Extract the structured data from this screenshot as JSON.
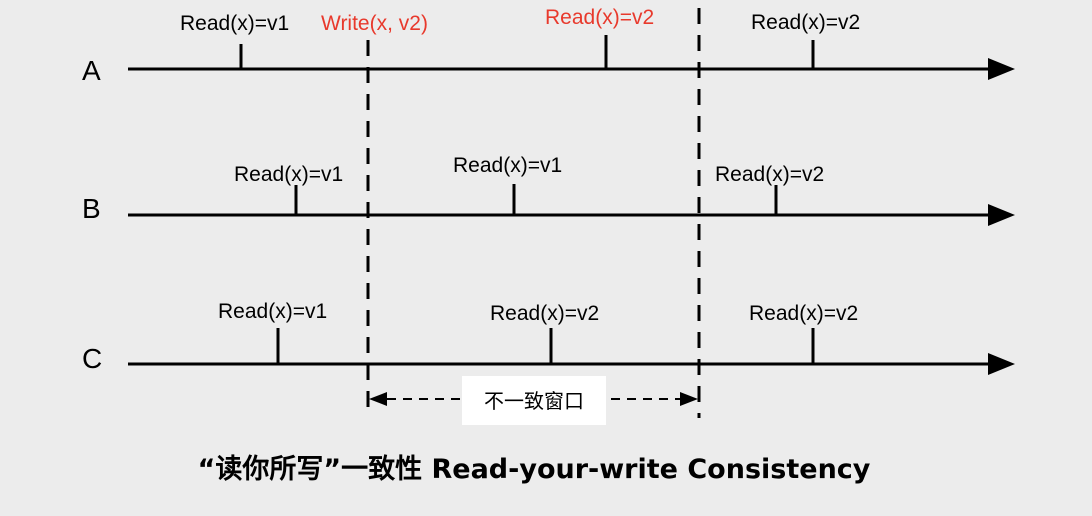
{
  "colors": {
    "background": "#ececec",
    "line": "#000000",
    "highlight": "#e8392c",
    "window_box": "#ffffff"
  },
  "processes": [
    {
      "name": "A",
      "events": [
        {
          "text": "Read(x)=v1",
          "highlight": false
        },
        {
          "text": "Write(x, v2)",
          "highlight": true
        },
        {
          "text": "Read(x)=v2",
          "highlight": true
        },
        {
          "text": "Read(x)=v2",
          "highlight": false
        }
      ]
    },
    {
      "name": "B",
      "events": [
        {
          "text": "Read(x)=v1",
          "highlight": false
        },
        {
          "text": "Read(x)=v1",
          "highlight": false
        },
        {
          "text": "Read(x)=v2",
          "highlight": false
        }
      ]
    },
    {
      "name": "C",
      "events": [
        {
          "text": "Read(x)=v1",
          "highlight": false
        },
        {
          "text": "Read(x)=v2",
          "highlight": false
        },
        {
          "text": "Read(x)=v2",
          "highlight": false
        }
      ]
    }
  ],
  "window_label": "不一致窗口",
  "title": "“读你所写”一致性 Read-your-write Consistency"
}
